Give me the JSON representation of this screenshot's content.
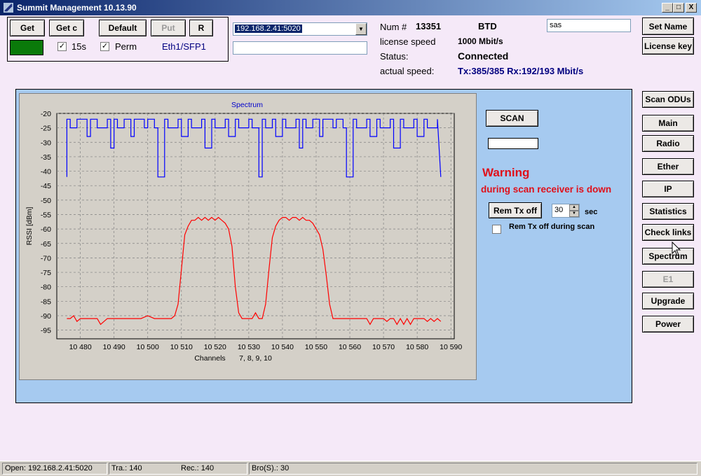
{
  "window": {
    "title": "Summit Management 10.13.90",
    "min_btn": "_",
    "max_btn": "□",
    "close_btn": "X"
  },
  "controls": {
    "get_label": "Get",
    "getc_label": "Get c",
    "default_label": "Default",
    "put_label": "Put",
    "r_label": "R",
    "status_color": "#0a7a0a",
    "chk_15s_label": "15s",
    "chk_perm_label": "Perm",
    "port_label": "Eth1/SFP1",
    "address_value": "192.168.2.41:5020",
    "address_empty": ""
  },
  "info": {
    "num_label": "Num #",
    "num_value": "13351",
    "model": "BTD",
    "license_label": "license speed",
    "license_value": "1000 Mbit/s",
    "status_label": "Status:",
    "status_value": "Connected",
    "actual_label": "actual speed:",
    "actual_value": "Tx:385/385 Rx:192/193 Mbit/s",
    "name_value": "sas"
  },
  "right_top": {
    "set_name": "Set Name",
    "license_key": "License key"
  },
  "nav": {
    "scan_odus": "Scan ODUs",
    "main": "Main",
    "radio": "Radio",
    "ether": "Ether",
    "ip": "IP",
    "statistics": "Statistics",
    "check_links": "Check links",
    "spectrum": "Spectrum",
    "e1": "E1",
    "upgrade": "Upgrade",
    "power": "Power"
  },
  "scan": {
    "scan_label": "SCAN",
    "warning_title": "Warning",
    "warning_text": "during scan receiver is down",
    "rem_tx_label": "Rem Tx  off",
    "spin_value": "30",
    "sec_label": "sec",
    "rem_tx_scan_label": "Rem Tx off during scan"
  },
  "statusbar": {
    "open": "Open: 192.168.2.41:5020",
    "tra": "Tra.: 140",
    "rec": "Rec.: 140",
    "bro": "Bro(S).: 30"
  },
  "chart_data": {
    "type": "line",
    "title": "Spectrum",
    "xlabel": "Channels",
    "xlabel_extra": "7, 8, 9, 10",
    "ylabel": "RSSI [dBm]",
    "xlim": [
      10473,
      10591
    ],
    "ylim": [
      -98,
      -20
    ],
    "xticks": [
      10480,
      10490,
      10500,
      10510,
      10520,
      10530,
      10540,
      10550,
      10560,
      10570,
      10580,
      10590
    ],
    "xtick_labels": [
      "10 480",
      "10 490",
      "10 500",
      "10 510",
      "10 520",
      "10 530",
      "10 540",
      "10 550",
      "10 560",
      "10 570",
      "10 580",
      "10 590"
    ],
    "yticks": [
      -20,
      -25,
      -30,
      -35,
      -40,
      -45,
      -50,
      -55,
      -60,
      -65,
      -70,
      -75,
      -80,
      -85,
      -90,
      -95
    ],
    "grid": true,
    "series": [
      {
        "name": "",
        "color": "#0000ff",
        "step": true,
        "x": [
          10476,
          10476,
          10477,
          10477,
          10479,
          10479,
          10482,
          10482,
          10483,
          10483,
          10485,
          10485,
          10488,
          10488,
          10489,
          10489,
          10490,
          10490,
          10491,
          10491,
          10493,
          10493,
          10495,
          10495,
          10496,
          10496,
          10499,
          10499,
          10500,
          10500,
          10502,
          10502,
          10503,
          10503,
          10505,
          10505,
          10506,
          10506,
          10509,
          10509,
          10510,
          10510,
          10512,
          10512,
          10513,
          10513,
          10516,
          10516,
          10517,
          10517,
          10519,
          10519,
          10520,
          10520,
          10523,
          10523,
          10524,
          10524,
          10526,
          10526,
          10527,
          10527,
          10530,
          10530,
          10531,
          10531,
          10533,
          10533,
          10534,
          10534,
          10535,
          10535,
          10537,
          10537,
          10538,
          10538,
          10540,
          10540,
          10541,
          10541,
          10544,
          10544,
          10545,
          10545,
          10546,
          10546,
          10547,
          10547,
          10549,
          10549,
          10551,
          10551,
          10552,
          10552,
          10555,
          10555,
          10556,
          10556,
          10558,
          10558,
          10559,
          10559,
          10561,
          10561,
          10562,
          10562,
          10565,
          10565,
          10566,
          10566,
          10568,
          10568,
          10569,
          10569,
          10572,
          10572,
          10573,
          10573,
          10575,
          10575,
          10576,
          10576,
          10579,
          10579,
          10580,
          10580,
          10582,
          10582,
          10583,
          10583,
          10586,
          10586,
          10587
        ],
        "y": [
          -42,
          -22,
          -22,
          -25,
          -25,
          -22,
          -22,
          -28,
          -28,
          -22,
          -22,
          -25,
          -25,
          -22,
          -22,
          -32,
          -32,
          -22,
          -22,
          -25,
          -25,
          -22,
          -22,
          -28,
          -28,
          -22,
          -22,
          -25,
          -25,
          -22,
          -22,
          -25,
          -25,
          -42,
          -42,
          -22,
          -22,
          -25,
          -25,
          -22,
          -22,
          -28,
          -28,
          -22,
          -22,
          -25,
          -25,
          -22,
          -22,
          -32,
          -32,
          -22,
          -22,
          -25,
          -25,
          -22,
          -22,
          -28,
          -28,
          -22,
          -22,
          -25,
          -25,
          -22,
          -22,
          -25,
          -25,
          -42,
          -42,
          -22,
          -22,
          -25,
          -25,
          -22,
          -22,
          -28,
          -28,
          -22,
          -22,
          -25,
          -25,
          -22,
          -22,
          -32,
          -32,
          -22,
          -22,
          -25,
          -25,
          -22,
          -22,
          -28,
          -28,
          -22,
          -22,
          -25,
          -25,
          -22,
          -22,
          -25,
          -25,
          -42,
          -42,
          -22,
          -22,
          -25,
          -25,
          -22,
          -22,
          -28,
          -28,
          -22,
          -22,
          -25,
          -25,
          -22,
          -22,
          -32,
          -32,
          -22,
          -22,
          -25,
          -25,
          -22,
          -22,
          -28,
          -28,
          -22,
          -22,
          -25,
          -25,
          -22,
          -42
        ]
      },
      {
        "name": "",
        "color": "#ff0000",
        "x": [
          10476,
          10477,
          10478,
          10479,
          10480,
          10482,
          10484,
          10485,
          10486,
          10488,
          10490,
          10492,
          10494,
          10495,
          10496,
          10498,
          10500,
          10502,
          10504,
          10505,
          10506,
          10507,
          10508,
          10509,
          10510,
          10511,
          10512,
          10513,
          10514,
          10515,
          10516,
          10517,
          10518,
          10519,
          10520,
          10521,
          10522,
          10523,
          10524,
          10525,
          10526,
          10527,
          10528,
          10529,
          10530,
          10531,
          10532,
          10533,
          10534,
          10535,
          10536,
          10537,
          10538,
          10539,
          10540,
          10541,
          10542,
          10543,
          10544,
          10545,
          10546,
          10547,
          10548,
          10549,
          10550,
          10551,
          10552,
          10553,
          10554,
          10555,
          10556,
          10557,
          10558,
          10559,
          10560,
          10561,
          10562,
          10563,
          10564,
          10565,
          10566,
          10567,
          10568,
          10569,
          10570,
          10571,
          10572,
          10573,
          10574,
          10575,
          10576,
          10577,
          10578,
          10579,
          10580,
          10581,
          10582,
          10583,
          10584,
          10585,
          10586,
          10587
        ],
        "y": [
          -91,
          -91,
          -90,
          -92,
          -91,
          -91,
          -91,
          -91,
          -93,
          -91,
          -91,
          -91,
          -91,
          -91,
          -91,
          -91,
          -90,
          -91,
          -91,
          -91,
          -91,
          -91,
          -90,
          -86,
          -74,
          -62,
          -59,
          -57,
          -57,
          -56,
          -57,
          -56,
          -57,
          -56,
          -57,
          -56,
          -57,
          -58,
          -60,
          -66,
          -80,
          -89,
          -91,
          -91,
          -91,
          -91,
          -89,
          -91,
          -91,
          -86,
          -74,
          -63,
          -59,
          -57,
          -56,
          -56,
          -57,
          -56,
          -56,
          -57,
          -56,
          -57,
          -57,
          -58,
          -60,
          -62,
          -67,
          -76,
          -86,
          -91,
          -91,
          -91,
          -91,
          -91,
          -91,
          -91,
          -91,
          -91,
          -91,
          -91,
          -93,
          -91,
          -91,
          -91,
          -91,
          -92,
          -91,
          -91,
          -93,
          -91,
          -93,
          -91,
          -93,
          -91,
          -91,
          -91,
          -91,
          -92,
          -91,
          -92,
          -91,
          -92
        ]
      }
    ]
  }
}
